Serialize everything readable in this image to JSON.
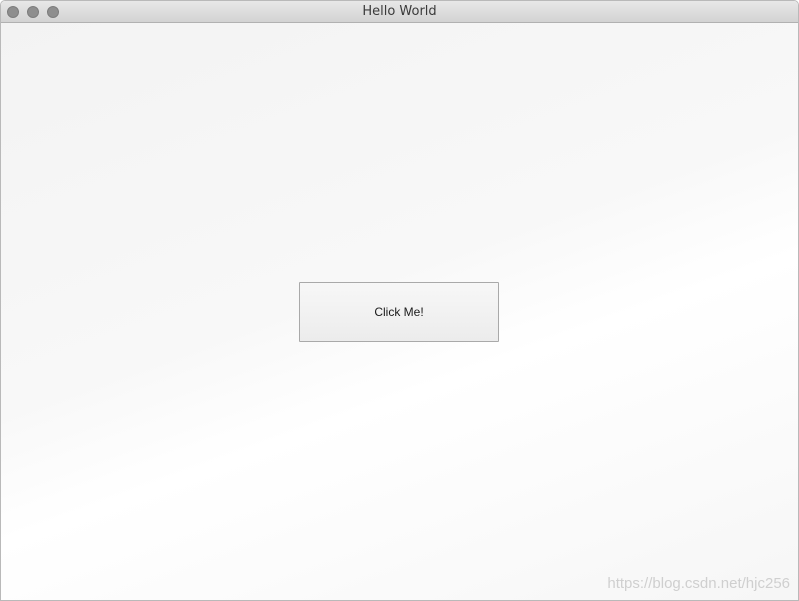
{
  "window": {
    "title": "Hello World"
  },
  "main": {
    "button_label": "Click Me!"
  },
  "watermark": {
    "text": "https://blog.csdn.net/hjc256"
  },
  "colors": {
    "titlebar": "#d8d8d8",
    "traffic_light": "#8e8e8e",
    "background": "#f4f4f4",
    "button_border": "#a9a9a9"
  },
  "icons": [
    "close-traffic-light-icon",
    "minimize-traffic-light-icon",
    "zoom-traffic-light-icon"
  ]
}
